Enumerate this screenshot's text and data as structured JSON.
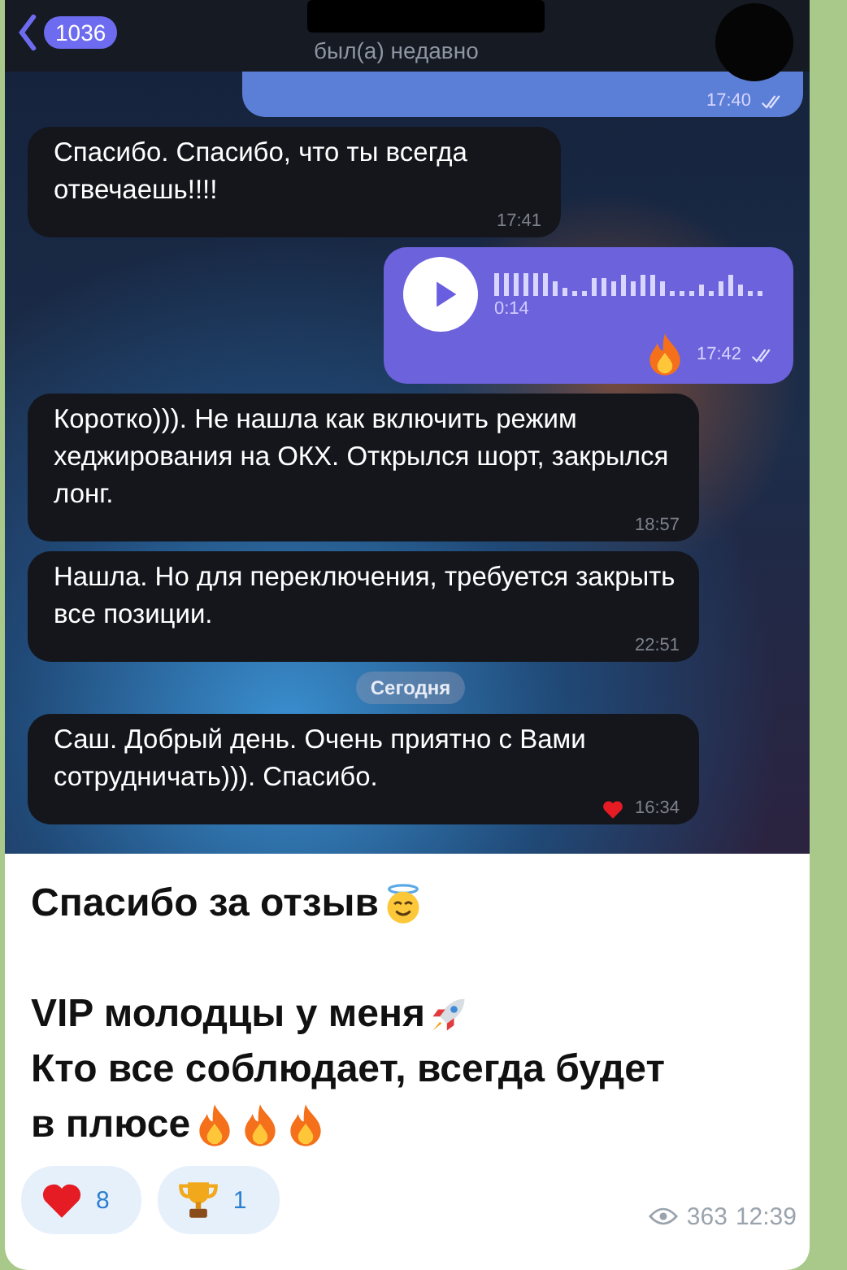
{
  "chat_screenshot": {
    "header": {
      "back_count": "1036",
      "status": "был(а) недавно"
    },
    "messages": [
      {
        "kind": "voice_cut",
        "time": "17:40",
        "read": true
      },
      {
        "kind": "text",
        "text": "Спасибо. Спасибо, что ты всегда отвечаешь!!!!",
        "time": "17:41",
        "reaction": false
      },
      {
        "kind": "voice",
        "duration": "0:14",
        "time": "17:42",
        "read": true,
        "reaction": true
      },
      {
        "kind": "text",
        "text": "Коротко))). Не нашла как включить режим хеджирования на ОКХ. Открылся шорт, закрылся лонг.",
        "time": "18:57",
        "reaction": false
      },
      {
        "kind": "text",
        "text": "Нашла. Но для переключения, требуется закрыть все позиции.",
        "time": "22:51",
        "reaction": false
      },
      {
        "kind": "date",
        "text": "Сегодня"
      },
      {
        "kind": "text",
        "text": "Саш. Добрый день. Очень приятно с Вами сотрудничать))). Спасибо.",
        "time": "16:34",
        "reaction": true
      }
    ]
  },
  "caption": [
    {
      "text": "Спасибо за отзыв",
      "emoji": [
        {
          "kind": "angel"
        }
      ]
    },
    {
      "text": "VIP молодцы у меня",
      "blank_before": true,
      "emoji": [
        {
          "kind": "rocket"
        }
      ]
    },
    {
      "text": "Кто все соблюдает, всегда будет"
    },
    {
      "text": "в плюсе",
      "emoji": [
        {
          "kind": "fire"
        },
        {
          "kind": "fire"
        },
        {
          "kind": "fire"
        }
      ]
    }
  ],
  "reactions": [
    {
      "kind": "heart",
      "count": "8"
    },
    {
      "kind": "trophy",
      "count": "1"
    }
  ],
  "views": "363",
  "time": "12:39"
}
